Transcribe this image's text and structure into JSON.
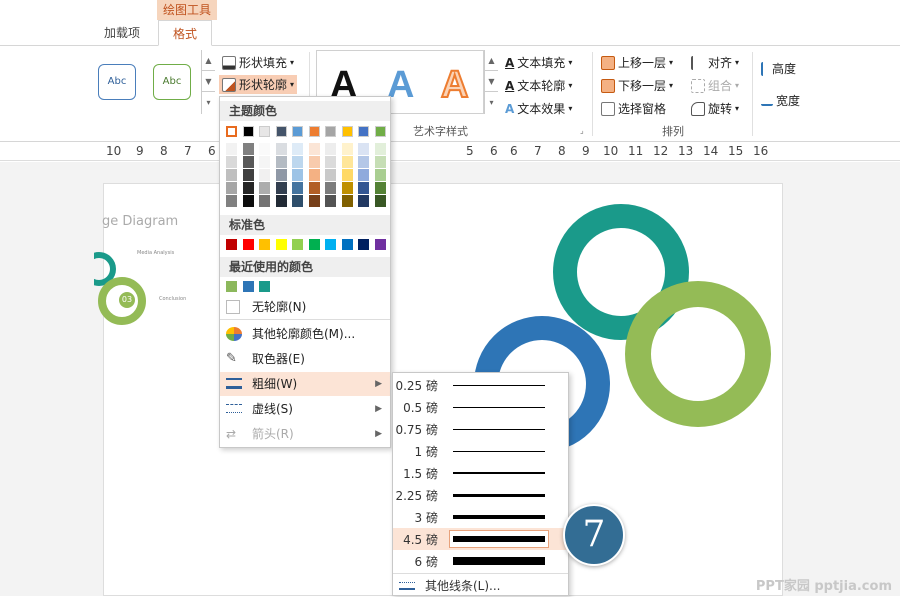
{
  "tabs": {
    "context_group": "绘图工具",
    "addins": "加载项",
    "format": "格式"
  },
  "ribbon": {
    "style_samples": [
      "Abc",
      "Abc"
    ],
    "shape_fill": "形状填充",
    "shape_outline": "形状轮廓",
    "wordart_group": "艺术字样式",
    "wordart_letter": "A",
    "text_fill": "文本填充",
    "text_outline": "文本轮廓",
    "text_effects": "文本效果",
    "bring_forward": "上移一层",
    "send_backward": "下移一层",
    "selection_pane": "选择窗格",
    "align": "对齐",
    "group": "组合",
    "rotate": "旋转",
    "arrange_group": "排列",
    "height": "高度",
    "width": "宽度"
  },
  "ruler": [
    "10",
    "9",
    "8",
    "7",
    "6",
    "6",
    "5",
    "6",
    "7",
    "8",
    "9",
    "10",
    "11",
    "12",
    "13",
    "14",
    "15",
    "16"
  ],
  "slide_thumb": {
    "title": "ge Diagram",
    "item1": "Media Analysis",
    "item2": "Conclusion",
    "number": "03"
  },
  "outline_menu": {
    "theme_colors_header": "主题颜色",
    "standard_colors_header": "标准色",
    "recent_colors_header": "最近使用的颜色",
    "no_outline": "无轮廓(N)",
    "more_colors": "其他轮廓颜色(M)...",
    "eyedropper": "取色器(E)",
    "weight": "粗细(W)",
    "dashes": "虚线(S)",
    "arrows": "箭头(R)"
  },
  "colors": {
    "theme_top": [
      "#ffffff",
      "#000000",
      "#e7e6e6",
      "#44546a",
      "#5b9bd5",
      "#ed7d31",
      "#a5a5a5",
      "#ffc000",
      "#4472c4",
      "#70ad47"
    ],
    "standard": [
      "#c00000",
      "#ff0000",
      "#ffc000",
      "#ffff00",
      "#92d050",
      "#00b050",
      "#00b0f0",
      "#0070c0",
      "#002060",
      "#7030a0"
    ],
    "recent": [
      "#8cb85c",
      "#2e75b6",
      "#1a9a8a"
    ],
    "accent": "#c0531f",
    "ring_teal": "#1a9a8a",
    "ring_blue": "#2e75b6",
    "ring_green": "#94bb56",
    "badge": "#336d94"
  },
  "weight_menu": {
    "options": [
      {
        "label": "0.25 磅",
        "pt": 0.25
      },
      {
        "label": "0.5 磅",
        "pt": 0.5
      },
      {
        "label": "0.75 磅",
        "pt": 0.75
      },
      {
        "label": "1 磅",
        "pt": 1
      },
      {
        "label": "1.5 磅",
        "pt": 1.5
      },
      {
        "label": "2.25 磅",
        "pt": 2.25
      },
      {
        "label": "3 磅",
        "pt": 3
      },
      {
        "label": "4.5 磅",
        "pt": 4.5
      },
      {
        "label": "6 磅",
        "pt": 6
      }
    ],
    "selected": "4.5 磅",
    "more_lines": "其他线条(L)..."
  },
  "step_badge": "7",
  "watermark": "PPT家园 pptjia.com"
}
